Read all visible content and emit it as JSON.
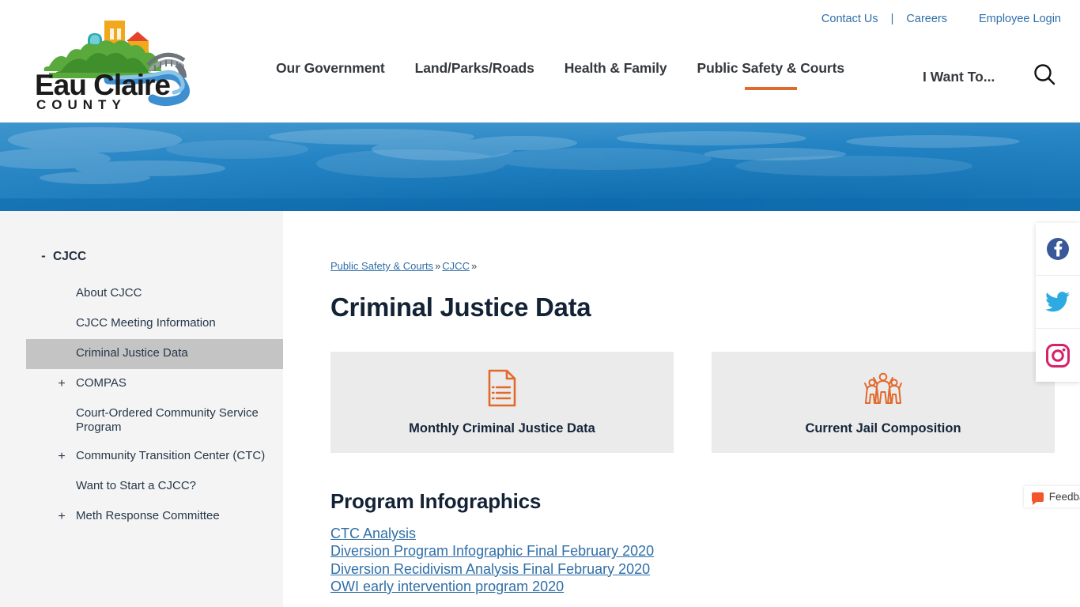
{
  "site": {
    "logo_line1": "Eau Claire",
    "logo_line2": "C O U N T Y",
    "logo_alt": "eau-claire-county-logo"
  },
  "header": {
    "utility_links": [
      {
        "label": "Contact Us",
        "name": "contact-us-link"
      },
      {
        "label": "|",
        "name": "utility-separator"
      },
      {
        "label": "Careers",
        "name": "careers-link"
      },
      {
        "label": "Employee Login",
        "name": "employee-login-link"
      }
    ],
    "nav_items": [
      {
        "label": "Our Government",
        "active": false
      },
      {
        "label": "Land/Parks/Roads",
        "active": false
      },
      {
        "label": "Health & Family",
        "active": false
      },
      {
        "label": "Public Safety & Courts",
        "active": true
      }
    ],
    "i_want_to": "I Want To...",
    "search_icon": "search-icon",
    "accent_color": "#e2692c"
  },
  "sidebar": {
    "items": [
      {
        "label": "CJCC",
        "level": 0,
        "toggle": "-",
        "selected": false
      },
      {
        "label": "About CJCC",
        "level": 1,
        "toggle": "",
        "selected": false
      },
      {
        "label": "CJCC Meeting Information",
        "level": 1,
        "toggle": "",
        "selected": false
      },
      {
        "label": "Criminal Justice Data",
        "level": 1,
        "toggle": "",
        "selected": true
      },
      {
        "label": "COMPAS",
        "level": 1,
        "toggle": "+",
        "selected": false
      },
      {
        "label": "Court-Ordered Community Service Program",
        "level": 1,
        "toggle": "",
        "selected": false
      },
      {
        "label": "Community Transition Center (CTC)",
        "level": 1,
        "toggle": "+",
        "selected": false
      },
      {
        "label": "Want to Start a CJCC?",
        "level": 1,
        "toggle": "",
        "selected": false
      },
      {
        "label": "Meth Response Committee",
        "level": 1,
        "toggle": "+",
        "selected": false
      }
    ]
  },
  "breadcrumb": {
    "crumb1": "Public Safety & Courts",
    "sep1": "»",
    "crumb2": "CJCC",
    "sep2": "»"
  },
  "main": {
    "page_title": "Criminal Justice Data",
    "feedback_label": "Feedback",
    "cards": [
      {
        "title": "Monthly Criminal Justice Data",
        "icon": "document-lines-icon"
      },
      {
        "title": "Current Jail Composition",
        "icon": "people-raised-arms-icon"
      }
    ],
    "section_title": "Program Infographics",
    "links": [
      "CTC Analysis",
      "Diversion Program Infographic Final February 2020",
      "Diversion Recidivism Analysis Final February 2020",
      "OWI early intervention program 2020"
    ]
  },
  "social": {
    "items": [
      {
        "name": "facebook-icon",
        "label": "Facebook",
        "color": "#395899"
      },
      {
        "name": "twitter-icon",
        "label": "Twitter",
        "color": "#2daae1"
      },
      {
        "name": "instagram-icon",
        "label": "Instagram",
        "color": "#d6216a"
      }
    ]
  },
  "colors": {
    "card_bg": "#ebebeb",
    "sidebar_bg": "#f4f4f4",
    "selected_bg": "#c4c4c4",
    "link_blue": "#2f6fa8",
    "icon_orange": "#e2692c",
    "hero_blue": "#1b7dc0"
  }
}
